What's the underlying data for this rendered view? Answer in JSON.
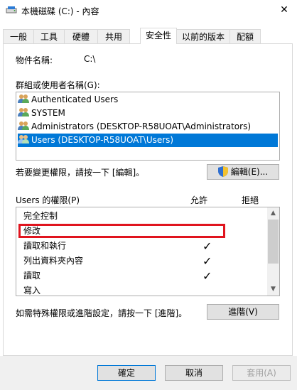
{
  "window": {
    "title": "本機磁碟 (C:) - 內容"
  },
  "tabs": [
    "一般",
    "工具",
    "硬體",
    "共用",
    "安全性",
    "以前的版本",
    "配額"
  ],
  "object_name": {
    "label": "物件名稱:",
    "value": "C:\\"
  },
  "groups": {
    "label": "群組或使用者名稱(G):",
    "items": [
      "Authenticated Users",
      "SYSTEM",
      "Administrators (DESKTOP-R58UOAT\\Administrators)",
      "Users (DESKTOP-R58UOAT\\Users)"
    ]
  },
  "change_perm": {
    "text": "若要變更權限，請按一下 [編輯]。",
    "button": "編輯(E)..."
  },
  "permissions": {
    "label": "Users 的權限(P)",
    "allow": "允許",
    "deny": "拒絕",
    "items": [
      "完全控制",
      "修改",
      "讀取和執行",
      "列出資料夾內容",
      "讀取",
      "寫入"
    ],
    "allow_check": "✓"
  },
  "advanced": {
    "text": "如需特殊權限或進階設定，請按一下 [進階]。",
    "button": "進階(V)"
  },
  "footer": {
    "ok": "確定",
    "cancel": "取消",
    "apply": "套用(A)"
  }
}
